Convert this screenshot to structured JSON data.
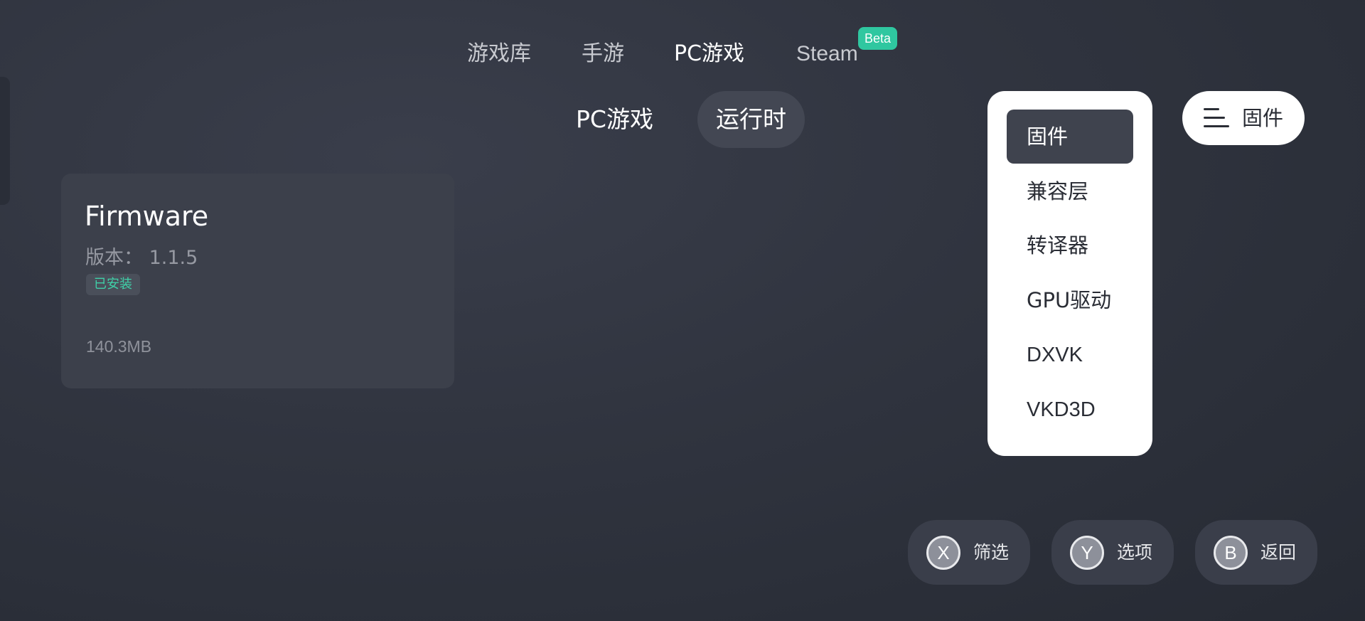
{
  "top_tabs": {
    "library": "游戏库",
    "mobile": "手游",
    "pc": "PC游戏",
    "steam": "Steam",
    "steam_badge": "Beta"
  },
  "sub_tabs": {
    "pc_games": "PC游戏",
    "runtime": "运行时"
  },
  "card": {
    "title": "Firmware",
    "version": "版本： 1.1.5",
    "status": "已安装",
    "size": "140.3MB"
  },
  "dropdown": {
    "items": [
      "固件",
      "兼容层",
      "转译器",
      "GPU驱动",
      "DXVK",
      "VKD3D"
    ],
    "selected_index": 0
  },
  "sort_button": {
    "label": "固件",
    "icon": "menu-lines-icon"
  },
  "controls": [
    {
      "key": "X",
      "label": "筛选"
    },
    {
      "key": "Y",
      "label": "选项"
    },
    {
      "key": "B",
      "label": "返回"
    }
  ],
  "colors": {
    "accent_green": "#2fc7a0",
    "installed_text": "#3fd0a8",
    "selected_item_bg": "#3f434e"
  }
}
